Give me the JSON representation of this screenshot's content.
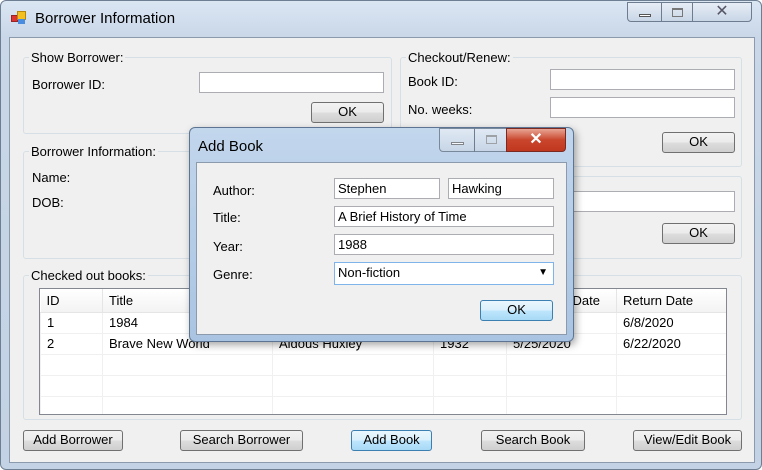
{
  "window": {
    "title": "Borrower Information",
    "icon": "app-icon"
  },
  "show_borrower": {
    "group": "Show Borrower:",
    "borrower_id_label": "Borrower ID:",
    "borrower_id_value": "",
    "ok": "OK"
  },
  "borrower_info": {
    "group": "Borrower Information:",
    "name_label": "Name:",
    "dob_label": "DOB:"
  },
  "checkout": {
    "group": "Checkout/Renew:",
    "book_id_label": "Book ID:",
    "book_id_value": "",
    "weeks_label": "No. weeks:",
    "weeks_value": "",
    "ok": "OK"
  },
  "return_group": {
    "value": "",
    "ok": "OK"
  },
  "checked_out": {
    "group": "Checked out books:",
    "headers": {
      "id": "ID",
      "title": "Title",
      "date_partial": "Date",
      "return": "Return Date"
    },
    "rows": [
      {
        "id": "1",
        "title": "1984",
        "author": "",
        "year": "",
        "checkout": "",
        "return": "6/8/2020"
      },
      {
        "id": "2",
        "title": "Brave New World",
        "author": "Aldous Huxley",
        "year": "1932",
        "checkout": "5/25/2020",
        "return": "6/22/2020"
      }
    ]
  },
  "buttons": {
    "add_borrower": "Add Borrower",
    "search_borrower": "Search Borrower",
    "add_book": "Add Book",
    "search_book": "Search Book",
    "view_edit_book": "View/Edit Book"
  },
  "dialog": {
    "title": "Add Book",
    "author_label": "Author:",
    "author_first": "Stephen",
    "author_last": "Hawking",
    "title_label": "Title:",
    "title_value": "A Brief History of Time",
    "year_label": "Year:",
    "year_value": "1988",
    "genre_label": "Genre:",
    "genre_value": "Non-fiction",
    "ok": "OK"
  }
}
